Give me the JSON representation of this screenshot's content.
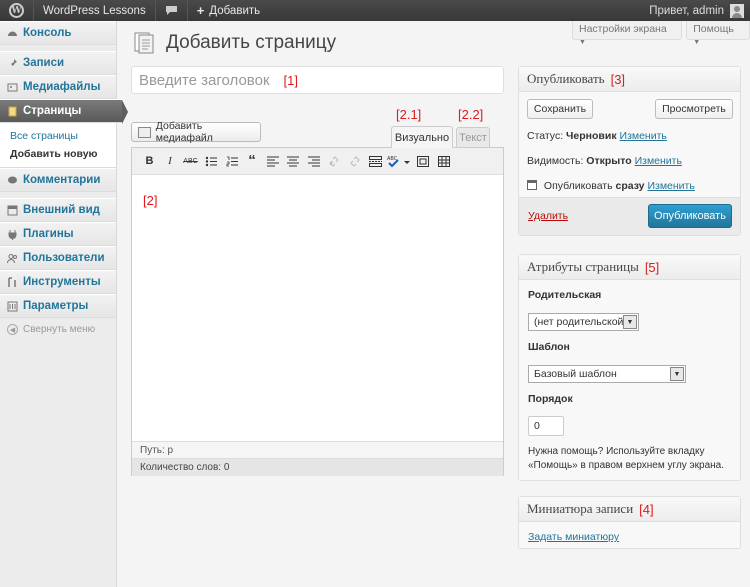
{
  "admin_bar": {
    "logo_icon": "wordpress-logo-icon",
    "site_name": "WordPress Lessons",
    "comments_icon": "speech-bubble-icon",
    "add_new": "Добавить",
    "greeting": "Привет, admin"
  },
  "screen_meta": {
    "screen_options": "Настройки экрана",
    "help": "Помощь"
  },
  "sidebar": {
    "items": [
      {
        "label": "Консоль",
        "icon": "dashboard-icon"
      },
      {
        "label": "Записи",
        "icon": "pin-icon"
      },
      {
        "label": "Медиафайлы",
        "icon": "media-icon"
      },
      {
        "label": "Страницы",
        "icon": "page-icon",
        "active": true
      },
      {
        "label": "Комментарии",
        "icon": "comments-icon"
      },
      {
        "label": "Внешний вид",
        "icon": "appearance-icon"
      },
      {
        "label": "Плагины",
        "icon": "plugin-icon"
      },
      {
        "label": "Пользователи",
        "icon": "users-icon"
      },
      {
        "label": "Инструменты",
        "icon": "tools-icon"
      },
      {
        "label": "Параметры",
        "icon": "settings-icon"
      }
    ],
    "submenu": [
      "Все страницы",
      "Добавить новую"
    ],
    "collapse": "Свернуть меню"
  },
  "main": {
    "title": "Добавить страницу",
    "title_placeholder": "Введите заголовок",
    "title_annotation": "[1]",
    "add_media": "Добавить медиафайл",
    "tab_visual": "Визуально",
    "tab_text": "Текст",
    "tab_visual_annotation": "[2.1]",
    "tab_text_annotation": "[2.2]",
    "editor_annotation": "[2]",
    "path": "Путь: p",
    "word_count": "Количество слов: 0"
  },
  "publish_box": {
    "title": "Опубликовать",
    "annotation": "[3]",
    "save": "Сохранить",
    "preview": "Просмотреть",
    "status_label": "Статус:",
    "status_value": "Черновик",
    "visibility_label": "Видимость:",
    "visibility_value": "Открыто",
    "schedule_label": "Опубликовать",
    "schedule_value": "сразу",
    "edit": "Изменить",
    "delete": "Удалить",
    "publish": "Опубликовать"
  },
  "attributes_box": {
    "title": "Атрибуты страницы",
    "annotation": "[5]",
    "parent_label": "Родительская",
    "parent_value": "(нет родительской)",
    "template_label": "Шаблон",
    "template_value": "Базовый шаблон",
    "order_label": "Порядок",
    "order_value": "0",
    "help_text": "Нужна помощь? Используйте вкладку «Помощь» в правом верхнем углу экрана."
  },
  "thumbnail_box": {
    "title": "Миниатюра записи",
    "annotation": "[4]",
    "set_link": "Задать миниатюру"
  }
}
